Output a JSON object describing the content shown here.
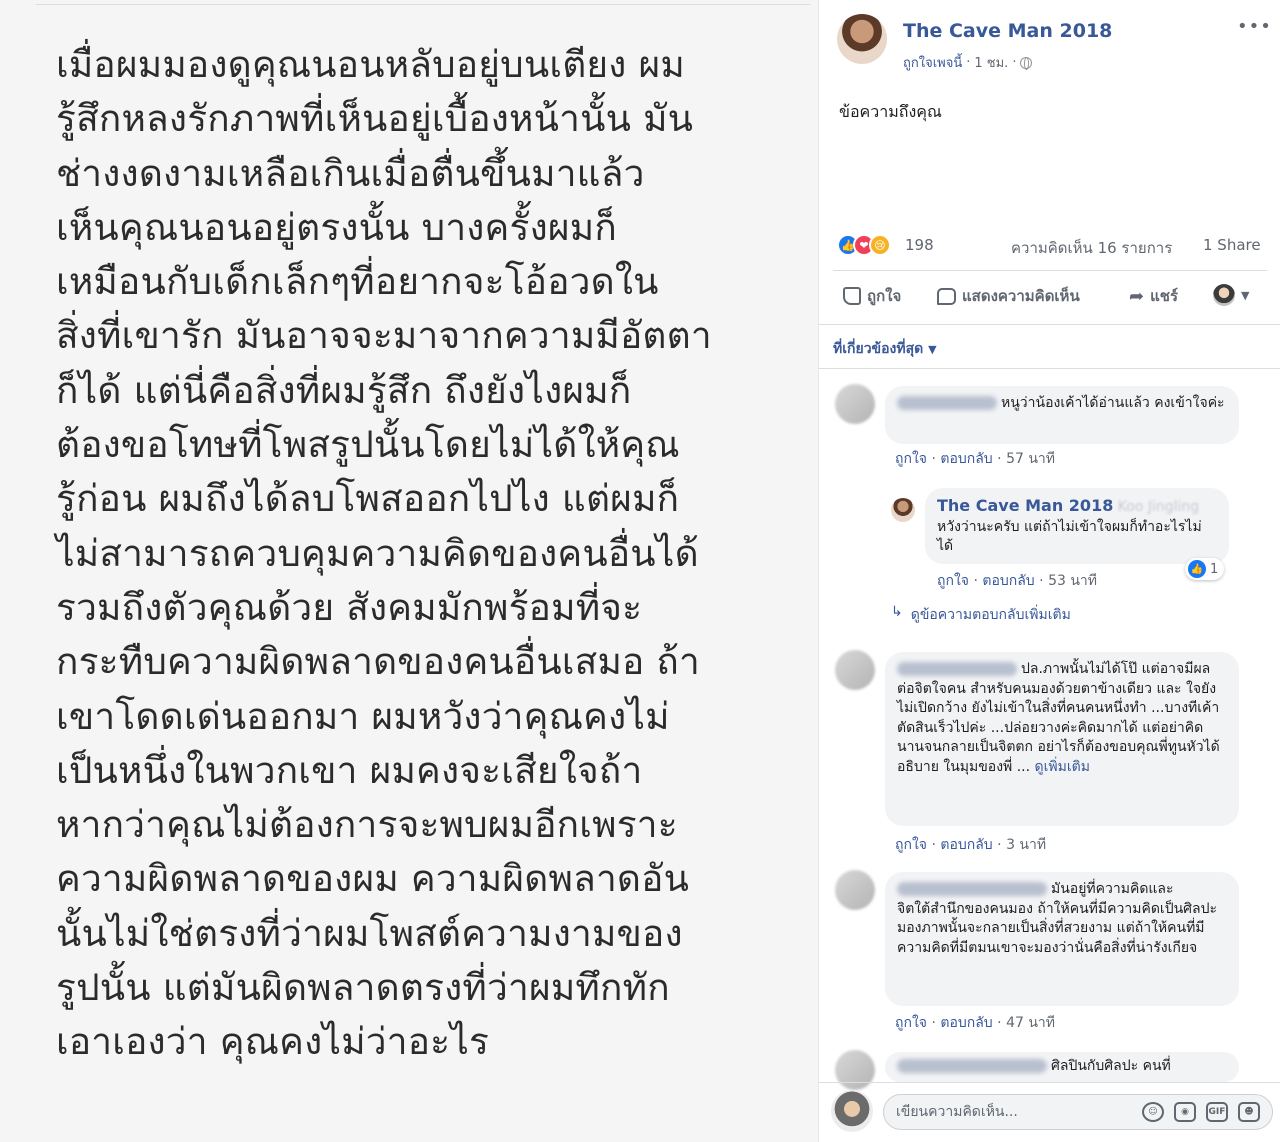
{
  "photo": {
    "lines": [
      "เมื่อผมมองดูคุณนอนหลับอยู่บนเตียง ผม",
      "รู้สึกหลงรักภาพที่เห็นอยู่เบื้องหน้านั้น มัน",
      "ช่างงดงามเหลือเกินเมื่อตื่นขึ้นมาแล้ว",
      "เห็นคุณนอนอยู่ตรงนั้น บางครั้งผมก็",
      "เหมือนกับเด็กเล็กๆที่อยากจะโอ้อวดใน",
      "สิ่งที่เขารัก มันอาจจะมาจากความมีอัตตา",
      "ก็ได้ แต่นี่คือสิ่งที่ผมรู้สึก ถึงยังไงผมก็",
      "ต้องขอโทษที่โพสรูปนั้นโดยไม่ได้ให้คุณ",
      "รู้ก่อน ผมถึงได้ลบโพสออกไปไง แต่ผมก็",
      "ไม่สามารถควบคุมความคิดของคนอื่นได้",
      "รวมถึงตัวคุณด้วย สังคมมักพร้อมที่จะ",
      "กระทืบความผิดพลาดของคนอื่นเสมอ ถ้า",
      "เขาโดดเด่นออกมา ผมหวังว่าคุณคงไม่",
      "เป็นหนึ่งในพวกเขา ผมคงจะเสียใจถ้า",
      "หากว่าคุณไม่ต้องการจะพบผมอีกเพราะ",
      "ความผิดพลาดของผม ความผิดพลาดอัน",
      "นั้นไม่ใช่ตรงที่ว่าผมโพสต์ความงามของ",
      "รูปนั้น แต่มันผิดพลาดตรงที่ว่าผมทึกทัก",
      "เอาเองว่า คุณคงไม่ว่าอะไร"
    ]
  },
  "post": {
    "page_name": "The Cave Man 2018",
    "liked_by_page": "ถูกใจเพจนี้",
    "separator": "·",
    "time": "1 ชม.",
    "more": "•••",
    "message": "ข้อความถึงคุณ",
    "reaction_count": "198",
    "comments_count": "ความคิดเห็น 16 รายการ",
    "share_count": "1 Share",
    "actions": {
      "like": "ถูกใจ",
      "comment": "แสดงความคิดเห็น",
      "share": "แชร์"
    },
    "sort_label": "ที่เกี่ยวข้องที่สุด"
  },
  "comments": [
    {
      "text": "หนูว่าน้องเค้าได้อ่านแล้ว คงเข้าใจค่ะ",
      "like": "ถูกใจ",
      "reply": "ตอบกลับ",
      "time": "57 นาที"
    },
    {
      "text": "ปล.ภาพนั้นไม่ได้โป๊ แต่อาจมีผลต่อจิตใจคน สำหรับคนมองด้วยตาข้างเดียว และ ใจยังไม่เปิดกว้าง ยังไม่เข้าในสิ่งที่คนคนหนึ่งทำ ...บางทีเค้าตัดสินเร็วไปค่ะ ...ปล่อยวางค่ะคิดมากได้ แต่อย่าคิดนานจนกลายเป็นจิตตก อย่าไรก็ต้องขอบคุณพี่ทูนหัวได้อธิบาย ในมุมของพี่ ...",
      "see_more": "ดูเพิ่มเติม",
      "like": "ถูกใจ",
      "reply": "ตอบกลับ",
      "time": "3 นาที"
    },
    {
      "text": "มันอยู่ที่ความคิดและจิตใต้สำนึกของคนมอง ถ้าให้คนที่มีความคิดเป็นศิลปะมองภาพนั้นจะกลายเป็นสิ่งที่สวยงาม แต่ถ้าให้คนที่มีความคิดที่มีตมนเขาจะมองว่านั่นคือสิ่งที่น่ารังเกียจ",
      "like": "ถูกใจ",
      "reply": "ตอบกลับ",
      "time": "47 นาที"
    },
    {
      "text": "ศิลปินกับศิลปะ คนที่"
    }
  ],
  "reply": {
    "author": "The Cave Man 2018",
    "tagged_name": "Koo Jingling",
    "text": "หวังว่านะครับ แต่ถ้าไม่เข้าใจผมก็ทำอะไรไม่ได้",
    "reaction_count": "1",
    "like": "ถูกใจ",
    "reply": "ตอบกลับ",
    "time": "53 นาที",
    "more_replies": "ดูข้อความตอบกลับเพิ่มเติม"
  },
  "composer": {
    "placeholder": "เขียนความคิดเห็น...",
    "gif_label": "GIF"
  },
  "colors": {
    "link": "#385898",
    "muted": "#606770",
    "bubble": "#f2f3f5",
    "like_blue": "#1877f2"
  }
}
